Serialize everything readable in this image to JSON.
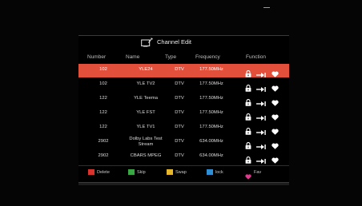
{
  "window": {
    "title": "Channel Edit"
  },
  "columns": {
    "number": "Number",
    "name": "Name",
    "type": "Type",
    "frequency": "Frequency",
    "function": "Function"
  },
  "channels": [
    {
      "number": "102",
      "name": "YLE24",
      "type": "DTV",
      "frequency": "177.50MHz",
      "selected": true
    },
    {
      "number": "102",
      "name": "YLE TV2",
      "type": "DTV",
      "frequency": "177.50MHz"
    },
    {
      "number": "122",
      "name": "YLE Teema",
      "type": "DTV",
      "frequency": "177.50MHz"
    },
    {
      "number": "122",
      "name": "YLE FST",
      "type": "DTV",
      "frequency": "177.50MHz"
    },
    {
      "number": "122",
      "name": "YLE TV1",
      "type": "DTV",
      "frequency": "177.50MHz"
    },
    {
      "number": "2902",
      "name": [
        "Dolby Labs Test",
        "Stream"
      ],
      "type": "DTV",
      "frequency": "634.00MHz"
    },
    {
      "number": "2902",
      "name": "CBARS MPEG",
      "type": "DTV",
      "frequency": "634.00MHz"
    }
  ],
  "function_icons": [
    "lock-icon",
    "skip-icon",
    "favorite-heart-icon"
  ],
  "legend": [
    {
      "label": "Delete",
      "color": "#d9332e",
      "icon": "red-key"
    },
    {
      "label": "Skip",
      "color": "#3aa745",
      "icon": "green-key"
    },
    {
      "label": "Swap",
      "color": "#e6b62b",
      "icon": "yellow-key"
    },
    {
      "label": "lock",
      "color": "#2f8fd4",
      "icon": "blue-key"
    },
    {
      "label": "Fav",
      "color": "#e0388c",
      "icon": "fav-heart-icon"
    }
  ],
  "colors": {
    "selected_row": "#e2503c",
    "background": "#000000"
  }
}
